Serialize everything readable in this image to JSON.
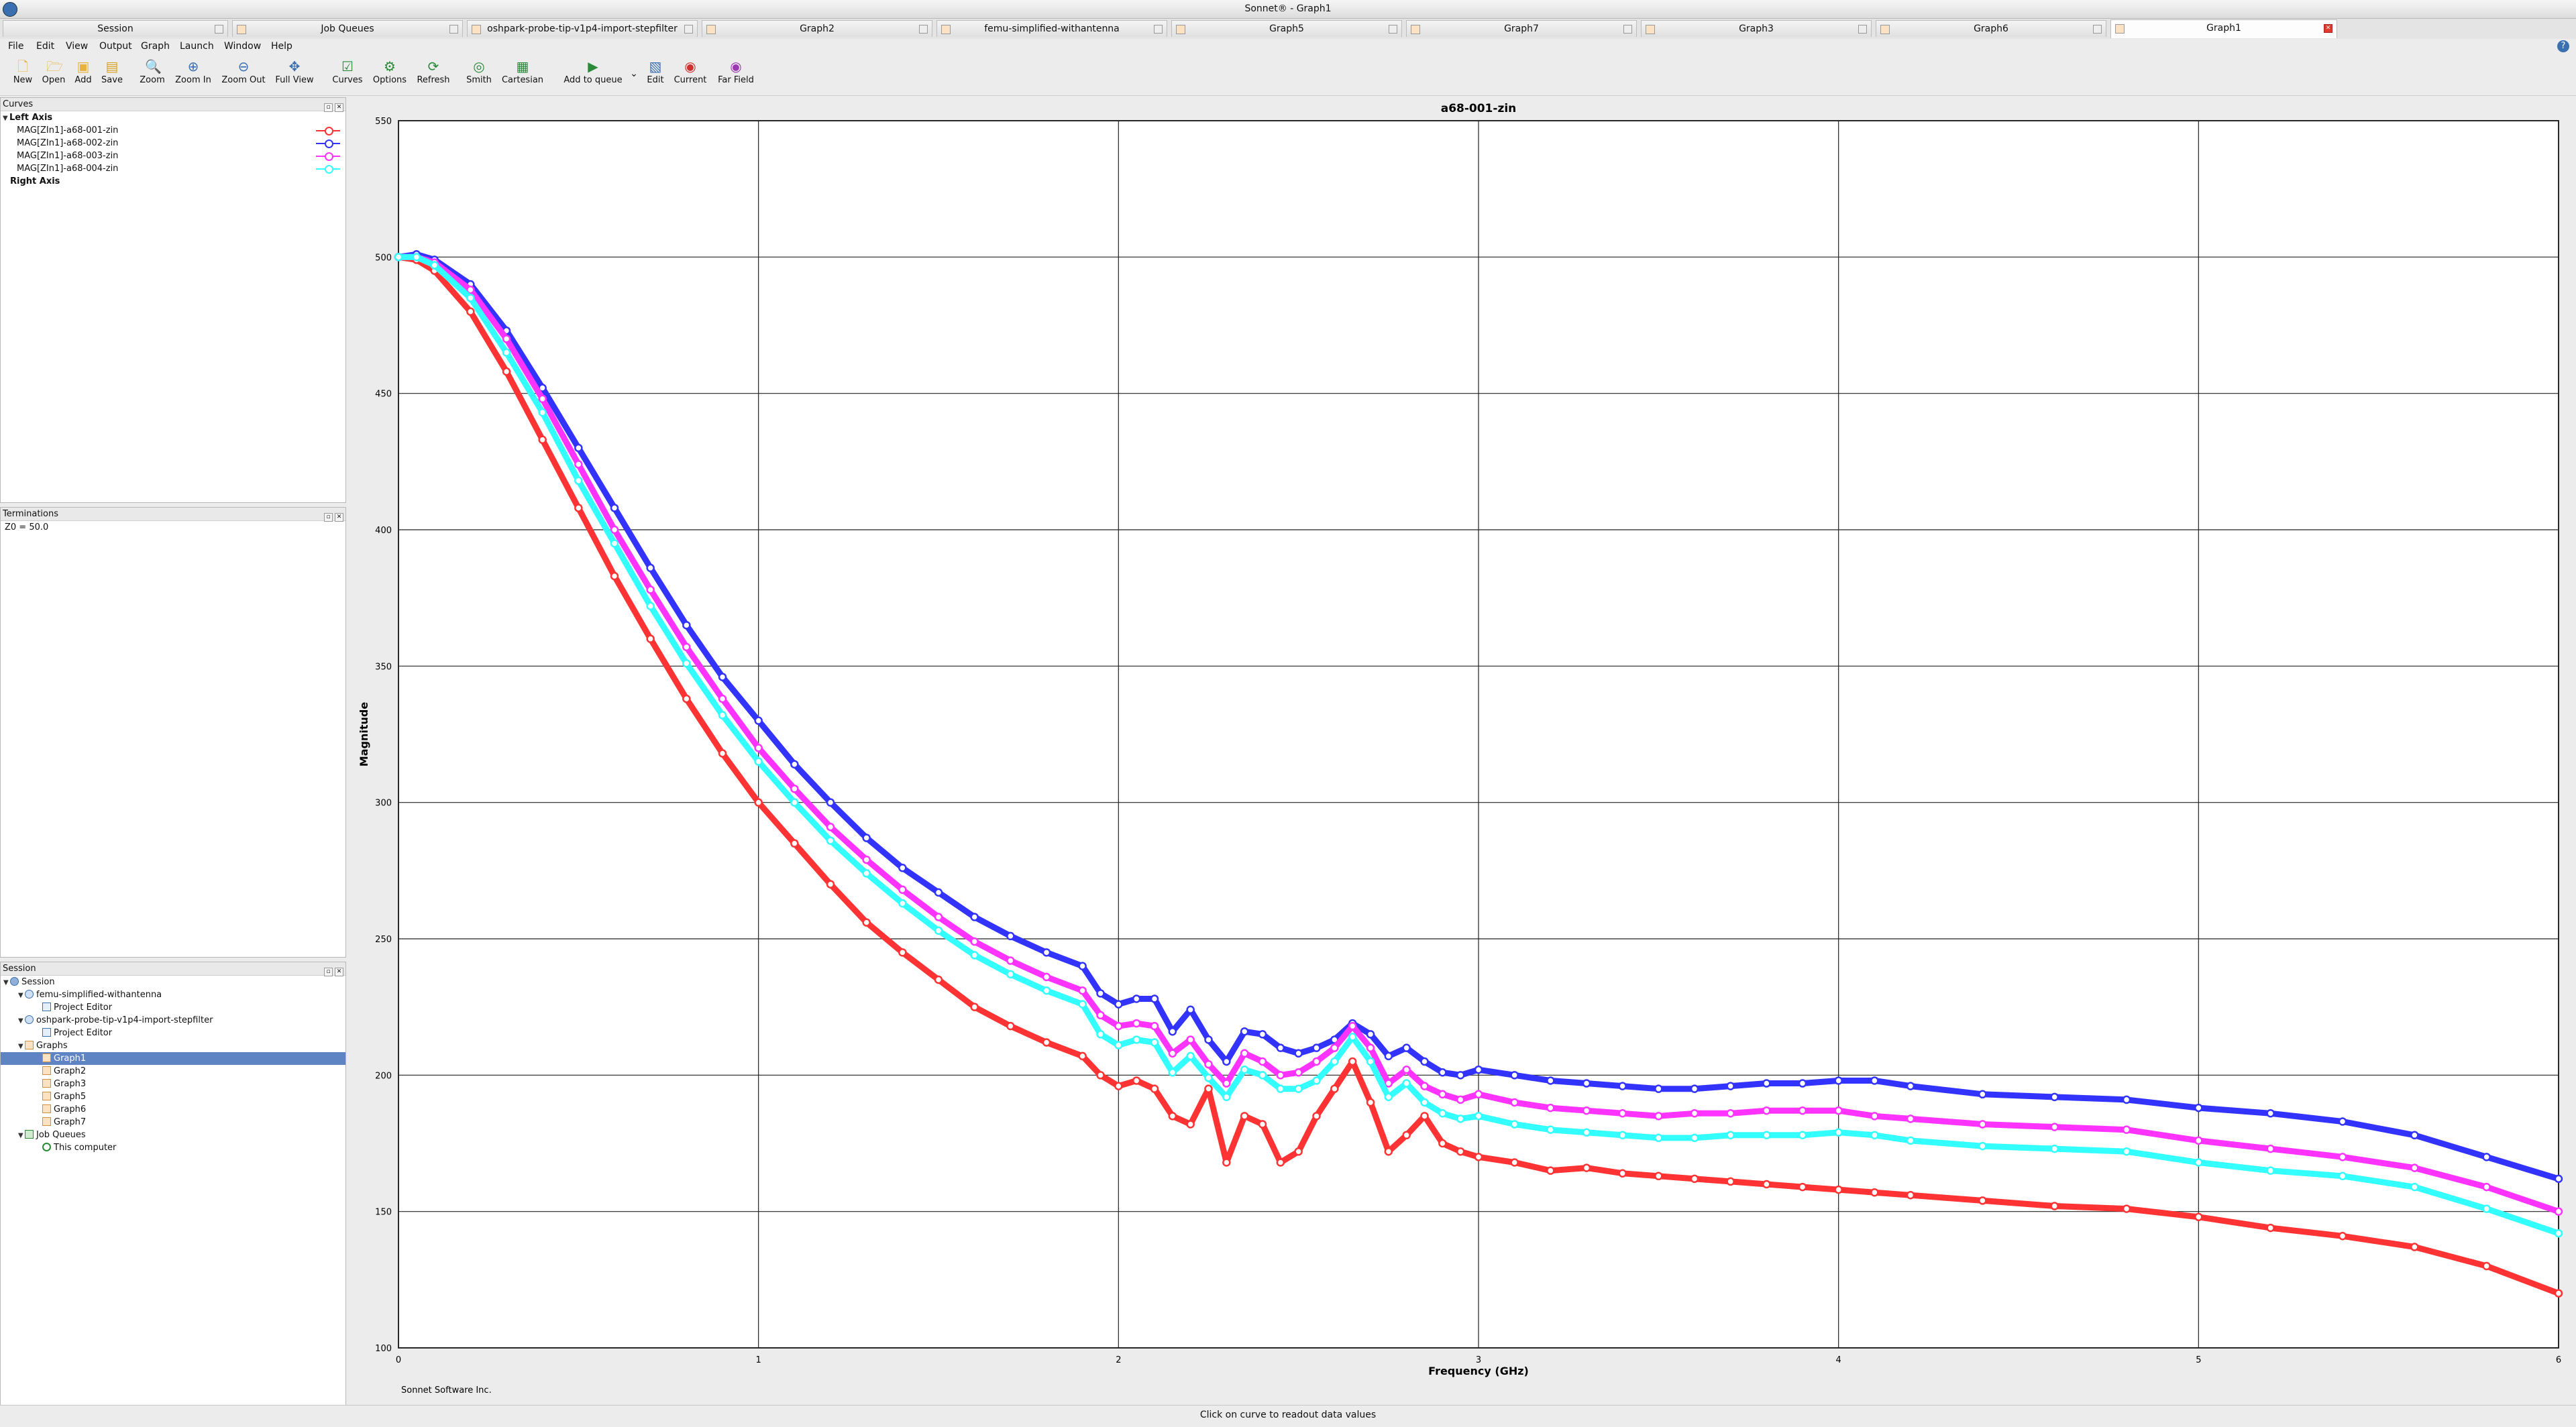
{
  "window": {
    "title": "Sonnet® - Graph1"
  },
  "tabs": [
    {
      "label": "Session",
      "active": false
    },
    {
      "label": "Job Queues",
      "active": false
    },
    {
      "label": "oshpark-probe-tip-v1p4-import-stepfilter",
      "active": false
    },
    {
      "label": "Graph2",
      "active": false
    },
    {
      "label": "femu-simplified-withantenna",
      "active": false
    },
    {
      "label": "Graph5",
      "active": false
    },
    {
      "label": "Graph7",
      "active": false
    },
    {
      "label": "Graph3",
      "active": false
    },
    {
      "label": "Graph6",
      "active": false
    },
    {
      "label": "Graph1",
      "active": true
    }
  ],
  "menu": [
    "File",
    "Edit",
    "View",
    "Output",
    "Graph",
    "Launch",
    "Window",
    "Help"
  ],
  "toolbar": [
    {
      "label": "New",
      "icon": "new-icon"
    },
    {
      "label": "Open",
      "icon": "open-icon"
    },
    {
      "label": "Add",
      "icon": "add-icon"
    },
    {
      "label": "Save",
      "icon": "save-icon"
    },
    {
      "label": "Zoom",
      "icon": "zoom-icon"
    },
    {
      "label": "Zoom In",
      "icon": "zoom-in-icon"
    },
    {
      "label": "Zoom Out",
      "icon": "zoom-out-icon"
    },
    {
      "label": "Full View",
      "icon": "full-view-icon"
    },
    {
      "label": "Curves",
      "icon": "curves-icon"
    },
    {
      "label": "Options",
      "icon": "options-icon"
    },
    {
      "label": "Refresh",
      "icon": "refresh-icon"
    },
    {
      "label": "Smith",
      "icon": "smith-icon"
    },
    {
      "label": "Cartesian",
      "icon": "cartesian-icon"
    },
    {
      "label": "Add to queue",
      "icon": "add-to-queue-icon"
    },
    {
      "label": "Edit",
      "icon": "edit-icon"
    },
    {
      "label": "Current",
      "icon": "current-icon"
    },
    {
      "label": "Far Field",
      "icon": "far-field-icon"
    }
  ],
  "curves_panel": {
    "title": "Curves",
    "left_axis_label": "Left Axis",
    "right_axis_label": "Right Axis",
    "items": [
      {
        "label": "MAG[ZIn1]-a68-001-zin",
        "color": "#ff3333"
      },
      {
        "label": "MAG[ZIn1]-a68-002-zin",
        "color": "#3333ff"
      },
      {
        "label": "MAG[ZIn1]-a68-003-zin",
        "color": "#ff33ff"
      },
      {
        "label": "MAG[ZIn1]-a68-004-zin",
        "color": "#33ffff"
      }
    ]
  },
  "terminations_panel": {
    "title": "Terminations",
    "text": "Z0 = 50.0"
  },
  "session_panel": {
    "title": "Session",
    "tree": [
      {
        "label": "Session",
        "level": 0,
        "expanded": true,
        "icon": "session-icon"
      },
      {
        "label": "femu-simplified-withantenna",
        "level": 1,
        "expanded": true,
        "icon": "project-icon"
      },
      {
        "label": "Project Editor",
        "level": 2,
        "icon": "editor-icon"
      },
      {
        "label": "oshpark-probe-tip-v1p4-import-stepfilter",
        "level": 1,
        "expanded": true,
        "icon": "project-icon"
      },
      {
        "label": "Project Editor",
        "level": 2,
        "icon": "editor-icon"
      },
      {
        "label": "Graphs",
        "level": 1,
        "expanded": true,
        "icon": "folder-icon"
      },
      {
        "label": "Graph1",
        "level": 2,
        "icon": "graph-icon",
        "selected": true
      },
      {
        "label": "Graph2",
        "level": 2,
        "icon": "graph-icon"
      },
      {
        "label": "Graph3",
        "level": 2,
        "icon": "graph-icon"
      },
      {
        "label": "Graph5",
        "level": 2,
        "icon": "graph-icon"
      },
      {
        "label": "Graph6",
        "level": 2,
        "icon": "graph-icon"
      },
      {
        "label": "Graph7",
        "level": 2,
        "icon": "graph-icon"
      },
      {
        "label": "Job Queues",
        "level": 1,
        "expanded": true,
        "icon": "job-queue-icon"
      },
      {
        "label": "This computer",
        "level": 2,
        "icon": "computer-check-icon"
      }
    ]
  },
  "footer_credit": "Sonnet Software Inc.",
  "status": "Click on curve to readout data values",
  "chart_data": {
    "type": "line",
    "title": "a68-001-zin",
    "xlabel": "Frequency (GHz)",
    "ylabel": "Magnitude",
    "xlim": [
      0,
      6
    ],
    "ylim": [
      100,
      550
    ],
    "xticks": [
      0,
      1,
      2,
      3,
      4,
      5,
      6
    ],
    "yticks": [
      100,
      150,
      200,
      250,
      300,
      350,
      400,
      450,
      500,
      550
    ],
    "grid": true,
    "series": [
      {
        "name": "MAG[ZIn1]-a68-001-zin",
        "color": "#ff3333",
        "x": [
          0,
          0.05,
          0.1,
          0.2,
          0.3,
          0.4,
          0.5,
          0.6,
          0.7,
          0.8,
          0.9,
          1.0,
          1.1,
          1.2,
          1.3,
          1.4,
          1.5,
          1.6,
          1.7,
          1.8,
          1.9,
          1.95,
          2.0,
          2.05,
          2.1,
          2.15,
          2.2,
          2.25,
          2.3,
          2.35,
          2.4,
          2.45,
          2.5,
          2.55,
          2.6,
          2.65,
          2.7,
          2.75,
          2.8,
          2.85,
          2.9,
          2.95,
          3.0,
          3.1,
          3.2,
          3.3,
          3.4,
          3.5,
          3.6,
          3.7,
          3.8,
          3.9,
          4.0,
          4.1,
          4.2,
          4.4,
          4.6,
          4.8,
          5.0,
          5.2,
          5.4,
          5.6,
          5.8,
          6.0
        ],
        "y": [
          500,
          499,
          495,
          480,
          458,
          433,
          408,
          383,
          360,
          338,
          318,
          300,
          285,
          270,
          256,
          245,
          235,
          225,
          218,
          212,
          207,
          200,
          196,
          198,
          195,
          185,
          182,
          195,
          168,
          185,
          182,
          168,
          172,
          185,
          195,
          205,
          190,
          172,
          178,
          185,
          175,
          172,
          170,
          168,
          165,
          166,
          164,
          163,
          162,
          161,
          160,
          159,
          158,
          157,
          156,
          154,
          152,
          151,
          148,
          144,
          141,
          137,
          130,
          120
        ]
      },
      {
        "name": "MAG[ZIn1]-a68-002-zin",
        "color": "#3333ff",
        "x": [
          0,
          0.05,
          0.1,
          0.2,
          0.3,
          0.4,
          0.5,
          0.6,
          0.7,
          0.8,
          0.9,
          1.0,
          1.1,
          1.2,
          1.3,
          1.4,
          1.5,
          1.6,
          1.7,
          1.8,
          1.9,
          1.95,
          2.0,
          2.05,
          2.1,
          2.15,
          2.2,
          2.25,
          2.3,
          2.35,
          2.4,
          2.45,
          2.5,
          2.55,
          2.6,
          2.65,
          2.7,
          2.75,
          2.8,
          2.85,
          2.9,
          2.95,
          3.0,
          3.1,
          3.2,
          3.3,
          3.4,
          3.5,
          3.6,
          3.7,
          3.8,
          3.9,
          4.0,
          4.1,
          4.2,
          4.4,
          4.6,
          4.8,
          5.0,
          5.2,
          5.4,
          5.6,
          5.8,
          6.0
        ],
        "y": [
          500,
          501,
          499,
          490,
          473,
          452,
          430,
          408,
          386,
          365,
          346,
          330,
          314,
          300,
          287,
          276,
          267,
          258,
          251,
          245,
          240,
          230,
          226,
          228,
          228,
          216,
          224,
          213,
          205,
          216,
          215,
          210,
          208,
          210,
          213,
          219,
          215,
          207,
          210,
          205,
          201,
          200,
          202,
          200,
          198,
          197,
          196,
          195,
          195,
          196,
          197,
          197,
          198,
          198,
          196,
          193,
          192,
          191,
          188,
          186,
          183,
          178,
          170,
          162
        ]
      },
      {
        "name": "MAG[ZIn1]-a68-003-zin",
        "color": "#ff33ff",
        "x": [
          0,
          0.05,
          0.1,
          0.2,
          0.3,
          0.4,
          0.5,
          0.6,
          0.7,
          0.8,
          0.9,
          1.0,
          1.1,
          1.2,
          1.3,
          1.4,
          1.5,
          1.6,
          1.7,
          1.8,
          1.9,
          1.95,
          2.0,
          2.05,
          2.1,
          2.15,
          2.2,
          2.25,
          2.3,
          2.35,
          2.4,
          2.45,
          2.5,
          2.55,
          2.6,
          2.65,
          2.7,
          2.75,
          2.8,
          2.85,
          2.9,
          2.95,
          3.0,
          3.1,
          3.2,
          3.3,
          3.4,
          3.5,
          3.6,
          3.7,
          3.8,
          3.9,
          4.0,
          4.1,
          4.2,
          4.4,
          4.6,
          4.8,
          5.0,
          5.2,
          5.4,
          5.6,
          5.8,
          6.0
        ],
        "y": [
          500,
          500,
          498,
          488,
          470,
          448,
          424,
          400,
          378,
          357,
          338,
          320,
          305,
          291,
          279,
          268,
          258,
          249,
          242,
          236,
          231,
          222,
          218,
          219,
          218,
          208,
          213,
          204,
          197,
          208,
          205,
          200,
          201,
          205,
          210,
          218,
          210,
          197,
          202,
          196,
          193,
          191,
          193,
          190,
          188,
          187,
          186,
          185,
          186,
          186,
          187,
          187,
          187,
          185,
          184,
          182,
          181,
          180,
          176,
          173,
          170,
          166,
          159,
          150
        ]
      },
      {
        "name": "MAG[ZIn1]-a68-004-zin",
        "color": "#33ffff",
        "x": [
          0,
          0.05,
          0.1,
          0.2,
          0.3,
          0.4,
          0.5,
          0.6,
          0.7,
          0.8,
          0.9,
          1.0,
          1.1,
          1.2,
          1.3,
          1.4,
          1.5,
          1.6,
          1.7,
          1.8,
          1.9,
          1.95,
          2.0,
          2.05,
          2.1,
          2.15,
          2.2,
          2.25,
          2.3,
          2.35,
          2.4,
          2.45,
          2.5,
          2.55,
          2.6,
          2.65,
          2.7,
          2.75,
          2.8,
          2.85,
          2.9,
          2.95,
          3.0,
          3.1,
          3.2,
          3.3,
          3.4,
          3.5,
          3.6,
          3.7,
          3.8,
          3.9,
          4.0,
          4.1,
          4.2,
          4.4,
          4.6,
          4.8,
          5.0,
          5.2,
          5.4,
          5.6,
          5.8,
          6.0
        ],
        "y": [
          500,
          500,
          497,
          485,
          465,
          443,
          418,
          395,
          372,
          351,
          332,
          315,
          300,
          286,
          274,
          263,
          253,
          244,
          237,
          231,
          226,
          215,
          211,
          213,
          212,
          201,
          207,
          199,
          192,
          202,
          200,
          195,
          195,
          198,
          205,
          214,
          205,
          192,
          197,
          190,
          186,
          184,
          185,
          182,
          180,
          179,
          178,
          177,
          177,
          178,
          178,
          178,
          179,
          178,
          176,
          174,
          173,
          172,
          168,
          165,
          163,
          159,
          151,
          142
        ]
      }
    ]
  }
}
